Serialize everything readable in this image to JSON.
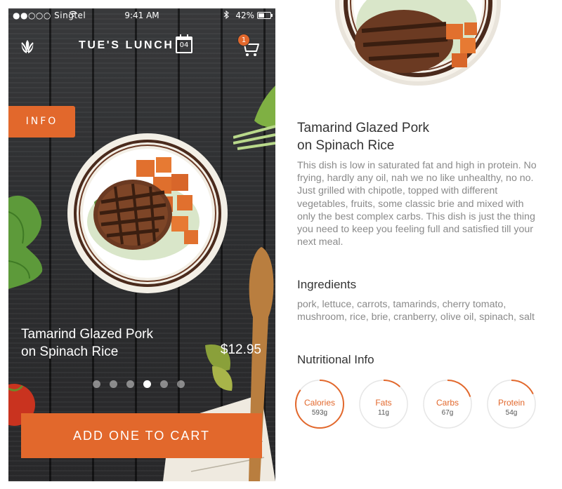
{
  "status_bar": {
    "carrier": "●●○○○ Singtel",
    "time": "9:41 AM",
    "battery": "42%",
    "bluetooth_icon": "bluetooth-icon",
    "wifi_icon": "wifi-icon"
  },
  "nav": {
    "title": "TUE'S LUNCH",
    "calendar_day": "04",
    "cart_count": "1",
    "logo_icon": "leaf-logo-icon"
  },
  "info_tab": {
    "label": "INFO"
  },
  "dish": {
    "name_line1": "Tamarind Glazed Pork",
    "name_line2": "on Spinach Rice",
    "price": "$12.95"
  },
  "pager": {
    "count": 6,
    "active": 3
  },
  "add_to_cart": {
    "label": "ADD ONE TO CART"
  },
  "details": {
    "title_line1": "Tamarind Glazed Pork",
    "title_line2": "on Spinach Rice",
    "description": "This dish is low in saturated fat and high in protein. No frying, hardly any oil, nah we no like unhealthy, no no. Just grilled with chipotle, topped with different vegetables, fruits, some classic brie and mixed with only the best complex carbs. This dish is just the thing you need to keep you feeling full and satisfied till your next meal.",
    "ingredients_heading": "Ingredients",
    "ingredients": "pork, lettuce, carrots, tamarinds, cherry tomato, mushroom, rice, brie, cranberry, olive oil, spinach, salt",
    "nutrition_heading": "Nutritional Info",
    "nutrition": [
      {
        "label": "Calories",
        "value": "593g",
        "fraction": 0.85
      },
      {
        "label": "Fats",
        "value": "11g",
        "fraction": 0.12
      },
      {
        "label": "Carbs",
        "value": "67g",
        "fraction": 0.2
      },
      {
        "label": "Protein",
        "value": "54g",
        "fraction": 0.18
      }
    ]
  },
  "colors": {
    "accent": "#e2682c",
    "ring_track": "#e6e6e6",
    "heading": "#333333",
    "body_text": "#8a8a8a"
  }
}
